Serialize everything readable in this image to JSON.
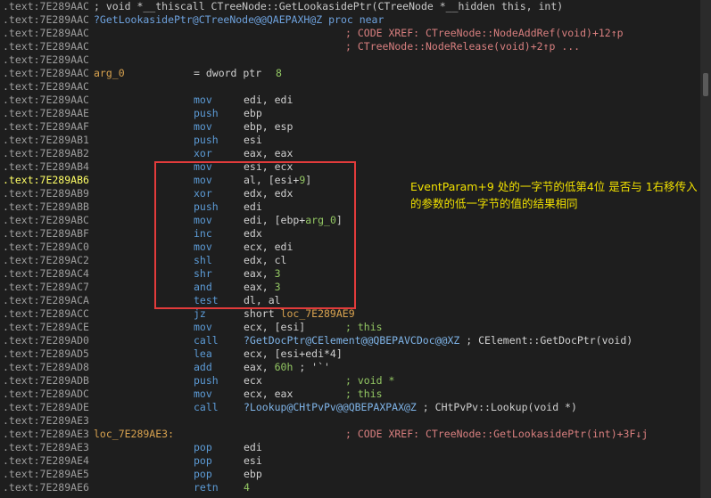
{
  "listing": [
    {
      "addr": ".text:7E289AAC",
      "rest": "; void *__thiscall CTreeNode::GetLookasidePtr(CTreeNode *__hidden this, int)"
    },
    {
      "addr": ".text:7E289AAC",
      "rest": "?GetLookasidePtr@CTreeNode@@QAEPAXH@Z proc near",
      "rest_color": "#6ea2de"
    },
    {
      "addr": ".text:7E289AAC",
      "comment": "; CODE XREF: CTreeNode::NodeAddRef(void)+12↑p"
    },
    {
      "addr": ".text:7E289AAC",
      "comment": "; CTreeNode::NodeRelease(void)+2↑p ..."
    },
    {
      "addr": ".text:7E289AAC"
    },
    {
      "addr": ".text:7E289AAC",
      "label": "arg_0",
      "eq": "= dword ptr",
      "val": "8"
    },
    {
      "addr": ".text:7E289AAC"
    },
    {
      "addr": ".text:7E289AAC",
      "mnem": "mov",
      "ops": [
        {
          "t": "edi, edi"
        }
      ]
    },
    {
      "addr": ".text:7E289AAE",
      "mnem": "push",
      "ops": [
        {
          "t": "ebp"
        }
      ]
    },
    {
      "addr": ".text:7E289AAF",
      "mnem": "mov",
      "ops": [
        {
          "t": "ebp, esp"
        }
      ]
    },
    {
      "addr": ".text:7E289AB1",
      "mnem": "push",
      "ops": [
        {
          "t": "esi"
        }
      ]
    },
    {
      "addr": ".text:7E289AB2",
      "mnem": "xor",
      "ops": [
        {
          "t": "eax, eax"
        }
      ]
    },
    {
      "addr": ".text:7E289AB4",
      "mnem": "mov",
      "ops": [
        {
          "t": "esi, ecx"
        }
      ]
    },
    {
      "addr": ".text:7E289AB6",
      "highlight": true,
      "mnem": "mov",
      "ops": [
        {
          "t": "al, [esi+"
        },
        {
          "t": "9",
          "k": "num"
        },
        {
          "t": "]"
        }
      ]
    },
    {
      "addr": ".text:7E289AB9",
      "mnem": "xor",
      "ops": [
        {
          "t": "edx, edx"
        }
      ]
    },
    {
      "addr": ".text:7E289ABB",
      "mnem": "push",
      "ops": [
        {
          "t": "edi"
        }
      ]
    },
    {
      "addr": ".text:7E289ABC",
      "mnem": "mov",
      "ops": [
        {
          "t": "edi, [ebp+"
        },
        {
          "t": "arg_0",
          "k": "argl"
        },
        {
          "t": "]"
        }
      ]
    },
    {
      "addr": ".text:7E289ABF",
      "mnem": "inc",
      "ops": [
        {
          "t": "edx"
        }
      ]
    },
    {
      "addr": ".text:7E289AC0",
      "mnem": "mov",
      "ops": [
        {
          "t": "ecx, edi"
        }
      ]
    },
    {
      "addr": ".text:7E289AC2",
      "mnem": "shl",
      "ops": [
        {
          "t": "edx, cl"
        }
      ]
    },
    {
      "addr": ".text:7E289AC4",
      "mnem": "shr",
      "ops": [
        {
          "t": "eax, "
        },
        {
          "t": "3",
          "k": "num"
        }
      ]
    },
    {
      "addr": ".text:7E289AC7",
      "mnem": "and",
      "ops": [
        {
          "t": "eax, "
        },
        {
          "t": "3",
          "k": "num"
        }
      ]
    },
    {
      "addr": ".text:7E289ACA",
      "mnem": "test",
      "ops": [
        {
          "t": "dl, al"
        }
      ]
    },
    {
      "addr": ".text:7E289ACC",
      "mnem": "jz",
      "ops": [
        {
          "t": "short "
        },
        {
          "t": "loc_7E289AE9",
          "k": "lbl"
        }
      ]
    },
    {
      "addr": ".text:7E289ACE",
      "mnem": "mov",
      "ops": [
        {
          "t": "ecx, [esi]"
        }
      ],
      "comment": "; this",
      "comment_color": "#93c763"
    },
    {
      "addr": ".text:7E289AD0",
      "mnem": "call",
      "ops": [
        {
          "t": "?GetDocPtr@CElement@@QBEPAVCDoc@@XZ",
          "k": "sym"
        },
        {
          "t": " ; CElement::GetDocPtr(void)"
        }
      ]
    },
    {
      "addr": ".text:7E289AD5",
      "mnem": "lea",
      "ops": [
        {
          "t": "ecx, [esi+edi*4]"
        }
      ]
    },
    {
      "addr": ".text:7E289AD8",
      "mnem": "add",
      "ops": [
        {
          "t": "eax, "
        },
        {
          "t": "60h",
          "k": "num"
        },
        {
          "t": " ; '`'"
        }
      ]
    },
    {
      "addr": ".text:7E289ADB",
      "mnem": "push",
      "ops": [
        {
          "t": "ecx"
        }
      ],
      "comment": "; void *",
      "comment_color": "#93c763"
    },
    {
      "addr": ".text:7E289ADC",
      "mnem": "mov",
      "ops": [
        {
          "t": "ecx, eax"
        }
      ],
      "comment": "; this",
      "comment_color": "#93c763"
    },
    {
      "addr": ".text:7E289ADE",
      "mnem": "call",
      "ops": [
        {
          "t": "?Lookup@CHtPvPv@@QBEPAXPAX@Z",
          "k": "sym"
        },
        {
          "t": " ; CHtPvPv::Lookup(void *)"
        }
      ]
    },
    {
      "addr": ".text:7E289AE3"
    },
    {
      "addr": ".text:7E289AE3",
      "loc": "loc_7E289AE3:",
      "loc_comment": "; CODE XREF: CTreeNode::GetLookasidePtr(int)+3F↓j"
    },
    {
      "addr": ".text:7E289AE3",
      "mnem": "pop",
      "ops": [
        {
          "t": "edi"
        }
      ]
    },
    {
      "addr": ".text:7E289AE4",
      "mnem": "pop",
      "ops": [
        {
          "t": "esi"
        }
      ]
    },
    {
      "addr": ".text:7E289AE5",
      "mnem": "pop",
      "ops": [
        {
          "t": "ebp"
        }
      ]
    },
    {
      "addr": ".text:7E289AE6",
      "mnem": "retn",
      "ops": [
        {
          "t": "4",
          "k": "num"
        }
      ]
    }
  ],
  "annotation": {
    "text": "EventParam+9 处的一字节的低第4位 是否与 1右移传入的参数的低一字节的值的结果相同"
  },
  "colors": {
    "background": "#1e1e1e",
    "address": "#9d9d9d",
    "address_highlight": "#ffff66",
    "mnemonic": "#5c9bd6",
    "xref_comment": "#d87f7f",
    "highlight_box": "#e23b3b",
    "annotation_text": "#f0e000"
  }
}
